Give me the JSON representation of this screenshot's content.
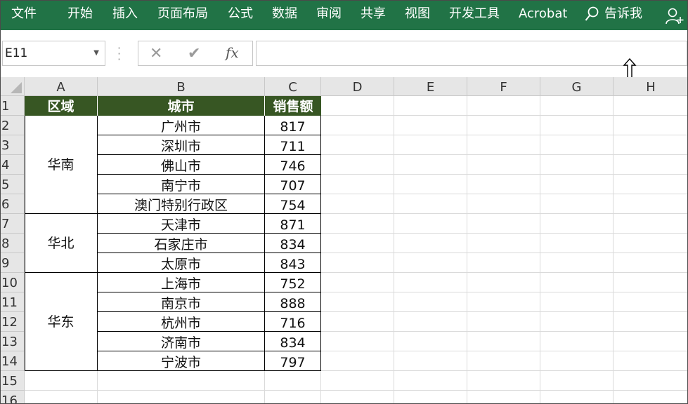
{
  "ribbon": {
    "tabs": [
      "文件",
      "开始",
      "插入",
      "页面布局",
      "公式",
      "数据",
      "审阅",
      "共享",
      "视图",
      "开发工具",
      "Acrobat"
    ],
    "tell_me": "告诉我"
  },
  "formula_bar": {
    "name_box": "E11",
    "formula": ""
  },
  "columns": [
    "A",
    "B",
    "C",
    "D",
    "E",
    "F",
    "G",
    "H"
  ],
  "rows": [
    "1",
    "2",
    "3",
    "4",
    "5",
    "6",
    "7",
    "8",
    "9",
    "10",
    "11",
    "12",
    "13",
    "14",
    "15",
    "16"
  ],
  "table": {
    "headers": [
      "区域",
      "城市",
      "销售额"
    ],
    "regions": [
      "华南",
      "华北",
      "华东"
    ],
    "cities": [
      "广州市",
      "深圳市",
      "佛山市",
      "南宁市",
      "澳门特别行政区",
      "天津市",
      "石家庄市",
      "太原市",
      "上海市",
      "南京市",
      "杭州市",
      "济南市",
      "宁波市"
    ],
    "sales": [
      "817",
      "711",
      "746",
      "707",
      "754",
      "871",
      "834",
      "843",
      "752",
      "888",
      "716",
      "834",
      "797"
    ]
  },
  "colors": {
    "ribbon": "#217346",
    "header_fill": "#375623"
  }
}
